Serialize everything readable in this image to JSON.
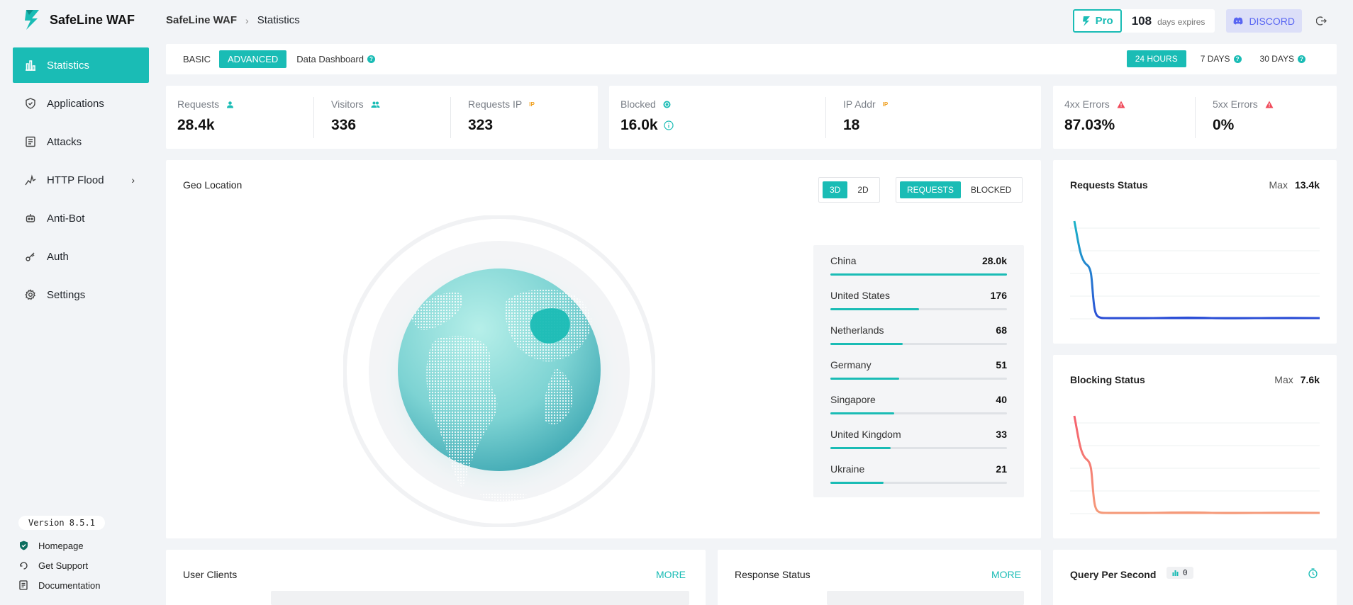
{
  "app": {
    "name": "SafeLine WAF"
  },
  "breadcrumb": {
    "root": "SafeLine WAF",
    "current": "Statistics"
  },
  "header": {
    "pro_label": "Pro",
    "days_value": "108",
    "days_label": "days expires",
    "discord_label": "DISCORD"
  },
  "sidebar": {
    "items": [
      {
        "label": "Statistics",
        "icon": "bar-chart-icon"
      },
      {
        "label": "Applications",
        "icon": "shield-icon"
      },
      {
        "label": "Attacks",
        "icon": "list-icon"
      },
      {
        "label": "HTTP Flood",
        "icon": "pulse-icon"
      },
      {
        "label": "Anti-Bot",
        "icon": "robot-icon"
      },
      {
        "label": "Auth",
        "icon": "key-icon"
      },
      {
        "label": "Settings",
        "icon": "gear-icon"
      }
    ],
    "version": "Version 8.5.1",
    "links": [
      {
        "label": "Homepage",
        "icon": "shield-home-icon"
      },
      {
        "label": "Get Support",
        "icon": "support-icon"
      },
      {
        "label": "Documentation",
        "icon": "document-icon"
      }
    ]
  },
  "tabs": {
    "basic": "BASIC",
    "advanced": "ADVANCED",
    "dashboard": "Data Dashboard"
  },
  "time_tabs": {
    "h24": "24 HOURS",
    "d7": "7 DAYS",
    "d30": "30 DAYS"
  },
  "stats": {
    "requests": {
      "label": "Requests",
      "value": "28.4k"
    },
    "visitors": {
      "label": "Visitors",
      "value": "336"
    },
    "requests_ip": {
      "label": "Requests IP",
      "value": "323",
      "tag": "IP"
    },
    "blocked": {
      "label": "Blocked",
      "value": "16.0k"
    },
    "ip_addr": {
      "label": "IP Addr",
      "value": "18",
      "tag": "IP"
    },
    "err4xx": {
      "label": "4xx Errors",
      "value": "87.03%"
    },
    "err5xx": {
      "label": "5xx Errors",
      "value": "0%"
    }
  },
  "geo": {
    "title": "Geo Location",
    "view_3d": "3D",
    "view_2d": "2D",
    "mode_requests": "REQUESTS",
    "mode_blocked": "BLOCKED",
    "countries": [
      {
        "name": "China",
        "value": "28.0k",
        "fill": 1.0
      },
      {
        "name": "United States",
        "value": "176",
        "fill": 0.5
      },
      {
        "name": "Netherlands",
        "value": "68",
        "fill": 0.41
      },
      {
        "name": "Germany",
        "value": "51",
        "fill": 0.39
      },
      {
        "name": "Singapore",
        "value": "40",
        "fill": 0.36
      },
      {
        "name": "United Kingdom",
        "value": "33",
        "fill": 0.34
      },
      {
        "name": "Ukraine",
        "value": "21",
        "fill": 0.3
      }
    ]
  },
  "requests_status": {
    "title": "Requests Status",
    "max_label": "Max",
    "max_value": "13.4k",
    "color": "#2c5fd6"
  },
  "blocking_status": {
    "title": "Blocking Status",
    "max_label": "Max",
    "max_value": "7.6k",
    "color": "#f5606d"
  },
  "user_clients": {
    "title": "User Clients",
    "more": "MORE"
  },
  "response_status": {
    "title": "Response Status",
    "more": "MORE"
  },
  "qps": {
    "title": "Query Per Second",
    "value": "0"
  },
  "colors": {
    "accent": "#1abcb5",
    "discord": "#5865f2"
  }
}
